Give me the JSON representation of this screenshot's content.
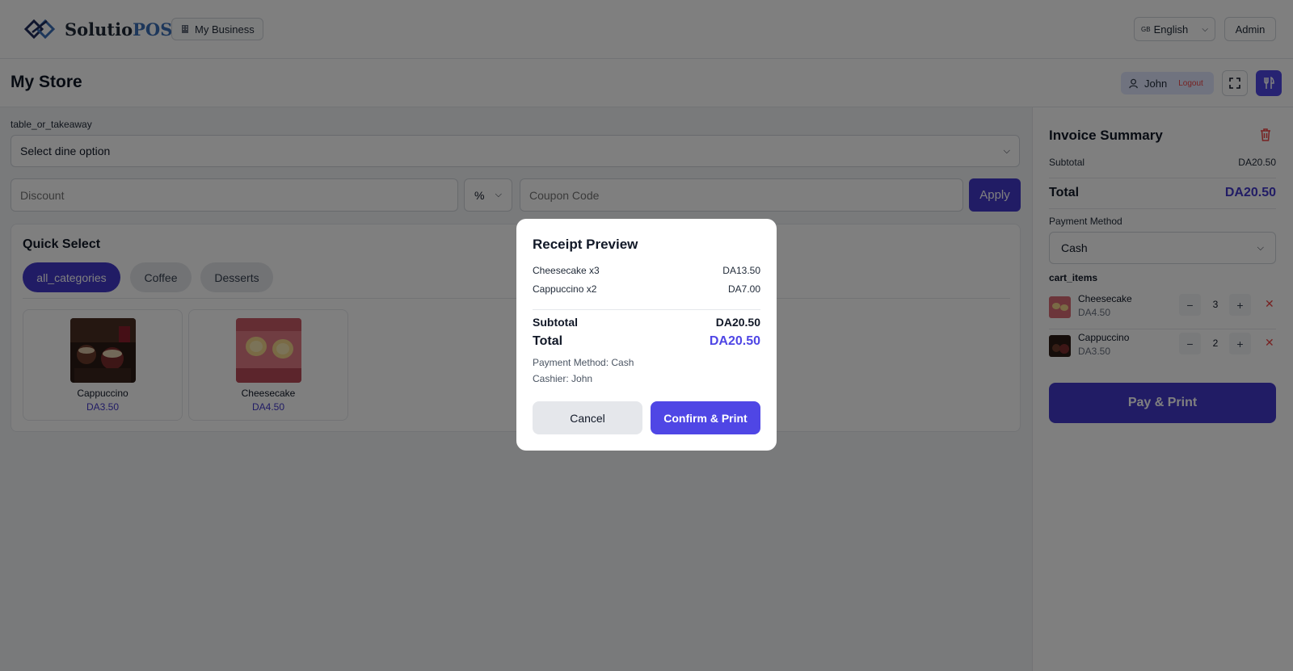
{
  "header": {
    "brand_main": "Solutio",
    "brand_accent": "POS",
    "business_label": "My Business",
    "language_flag": "GB",
    "language_label": "English",
    "admin_label": "Admin"
  },
  "store": {
    "title": "My Store",
    "user_name": "John",
    "logout_label": "Logout"
  },
  "order": {
    "dine_label": "table_or_takeaway",
    "dine_selected": "Select dine option",
    "discount_placeholder": "Discount",
    "discount_type": "%",
    "coupon_placeholder": "Coupon Code",
    "apply_label": "Apply"
  },
  "quick_select": {
    "title": "Quick Select",
    "categories": [
      {
        "label": "all_categories",
        "active": true
      },
      {
        "label": "Coffee",
        "active": false
      },
      {
        "label": "Desserts",
        "active": false
      }
    ],
    "products": [
      {
        "name": "Cappuccino",
        "price": "DA3.50"
      },
      {
        "name": "Cheesecake",
        "price": "DA4.50"
      }
    ]
  },
  "invoice": {
    "title": "Invoice Summary",
    "subtotal_label": "Subtotal",
    "subtotal_value": "DA20.50",
    "total_label": "Total",
    "total_value": "DA20.50",
    "payment_label": "Payment Method",
    "payment_selected": "Cash",
    "cart_label": "cart_items",
    "items": [
      {
        "name": "Cheesecake",
        "price": "DA4.50",
        "qty": "3"
      },
      {
        "name": "Cappuccino",
        "price": "DA3.50",
        "qty": "2"
      }
    ],
    "pay_label": "Pay & Print"
  },
  "modal": {
    "title": "Receipt Preview",
    "lines": [
      {
        "label": "Cheesecake x3",
        "value": "DA13.50"
      },
      {
        "label": "Cappuccino x2",
        "value": "DA7.00"
      }
    ],
    "subtotal_label": "Subtotal",
    "subtotal_value": "DA20.50",
    "total_label": "Total",
    "total_value": "DA20.50",
    "payment_text": "Payment Method: Cash",
    "cashier_text": "Cashier: John",
    "cancel_label": "Cancel",
    "confirm_label": "Confirm & Print"
  },
  "colors": {
    "accent": "#4338ca",
    "accent_bright": "#4f46e5",
    "danger": "#ef4444"
  }
}
